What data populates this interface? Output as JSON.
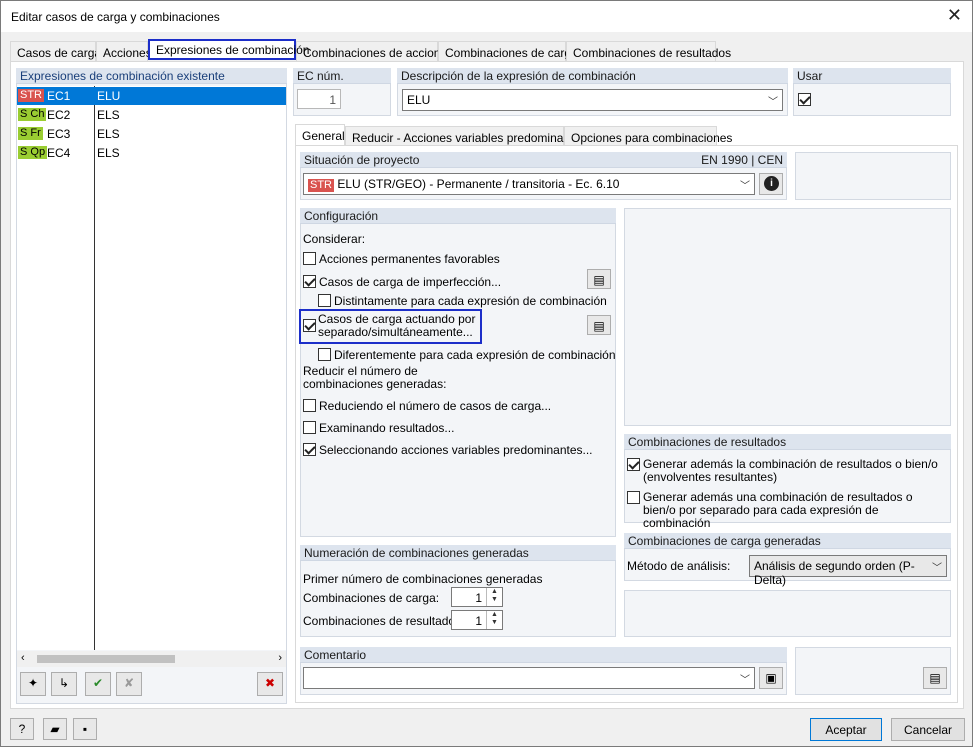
{
  "window": {
    "title": "Editar casos de carga y combinaciones"
  },
  "tabs": [
    "Casos de carga",
    "Acciones",
    "Expresiones de combinación",
    "Combinaciones de acciones",
    "Combinaciones de carga",
    "Combinaciones de resultados"
  ],
  "left": {
    "header": "Expresiones de combinación existente",
    "rows": [
      {
        "tag": "STR",
        "tag_color": "#d9534f",
        "tag_text_color": "#ffffff",
        "id": "EC1",
        "desc": "ELU",
        "selected": true
      },
      {
        "tag": "S Ch",
        "tag_color": "#9acd32",
        "tag_text_color": "#000000",
        "id": "EC2",
        "desc": "ELS",
        "selected": false
      },
      {
        "tag": "S Fr",
        "tag_color": "#9acd32",
        "tag_text_color": "#000000",
        "id": "EC3",
        "desc": "ELS",
        "selected": false
      },
      {
        "tag": "S Qp",
        "tag_color": "#9acd32",
        "tag_text_color": "#000000",
        "id": "EC4",
        "desc": "ELS",
        "selected": false
      }
    ]
  },
  "ec_num": {
    "label": "EC núm.",
    "value": "1"
  },
  "descripcion": {
    "label": "Descripción de la expresión de combinación",
    "value": "ELU"
  },
  "usar": {
    "label": "Usar",
    "checked": true
  },
  "subtabs": [
    "General",
    "Reducir - Acciones variables predominantes",
    "Opciones para combinaciones"
  ],
  "situacion": {
    "label": "Situación de proyecto",
    "norm": "EN 1990 | CEN",
    "tag": "STR",
    "value": "ELU (STR/GEO) - Permanente / transitoria - Ec. 6.10"
  },
  "config": {
    "header": "Configuración",
    "considerar": "Considerar:",
    "items": [
      {
        "label": "Acciones permanentes favorables",
        "checked": false
      },
      {
        "label": "Casos de carga de imperfección...",
        "checked": true
      },
      {
        "label": "Distintamente para cada expresión de combinación",
        "checked": false
      },
      {
        "label": "Casos de carga actuando por separado/simultáneamente...",
        "checked": true
      },
      {
        "label": "Diferentemente para cada expresión de combinación",
        "checked": false
      }
    ],
    "reducir": "Reducir el número de combinaciones generadas:",
    "reducir_items": [
      {
        "label": "Reduciendo el número de casos de carga...",
        "checked": false
      },
      {
        "label": "Examinando resultados...",
        "checked": false
      },
      {
        "label": "Seleccionando acciones variables predominantes...",
        "checked": true
      }
    ]
  },
  "comb_resultados": {
    "header": "Combinaciones de resultados",
    "items": [
      {
        "label": "Generar además la combinación de resultados o bien/o (envolventes resultantes)",
        "checked": true
      },
      {
        "label": "Generar además una combinación de resultados o bien/o por separado para cada expresión de combinación",
        "checked": false
      }
    ]
  },
  "numeracion": {
    "header": "Numeración de combinaciones generadas",
    "primer": "Primer número de combinaciones generadas",
    "carga_label": "Combinaciones de carga:",
    "carga_value": "1",
    "resultados_label": "Combinaciones de resultados:",
    "resultados_value": "1"
  },
  "comb_carga": {
    "header": "Combinaciones de carga generadas",
    "metodo_label": "Método de análisis:",
    "metodo_value": "Análisis de segundo orden (P-Delta)"
  },
  "comentario": {
    "label": "Comentario",
    "value": ""
  },
  "buttons": {
    "aceptar": "Aceptar",
    "cancelar": "Cancelar"
  }
}
